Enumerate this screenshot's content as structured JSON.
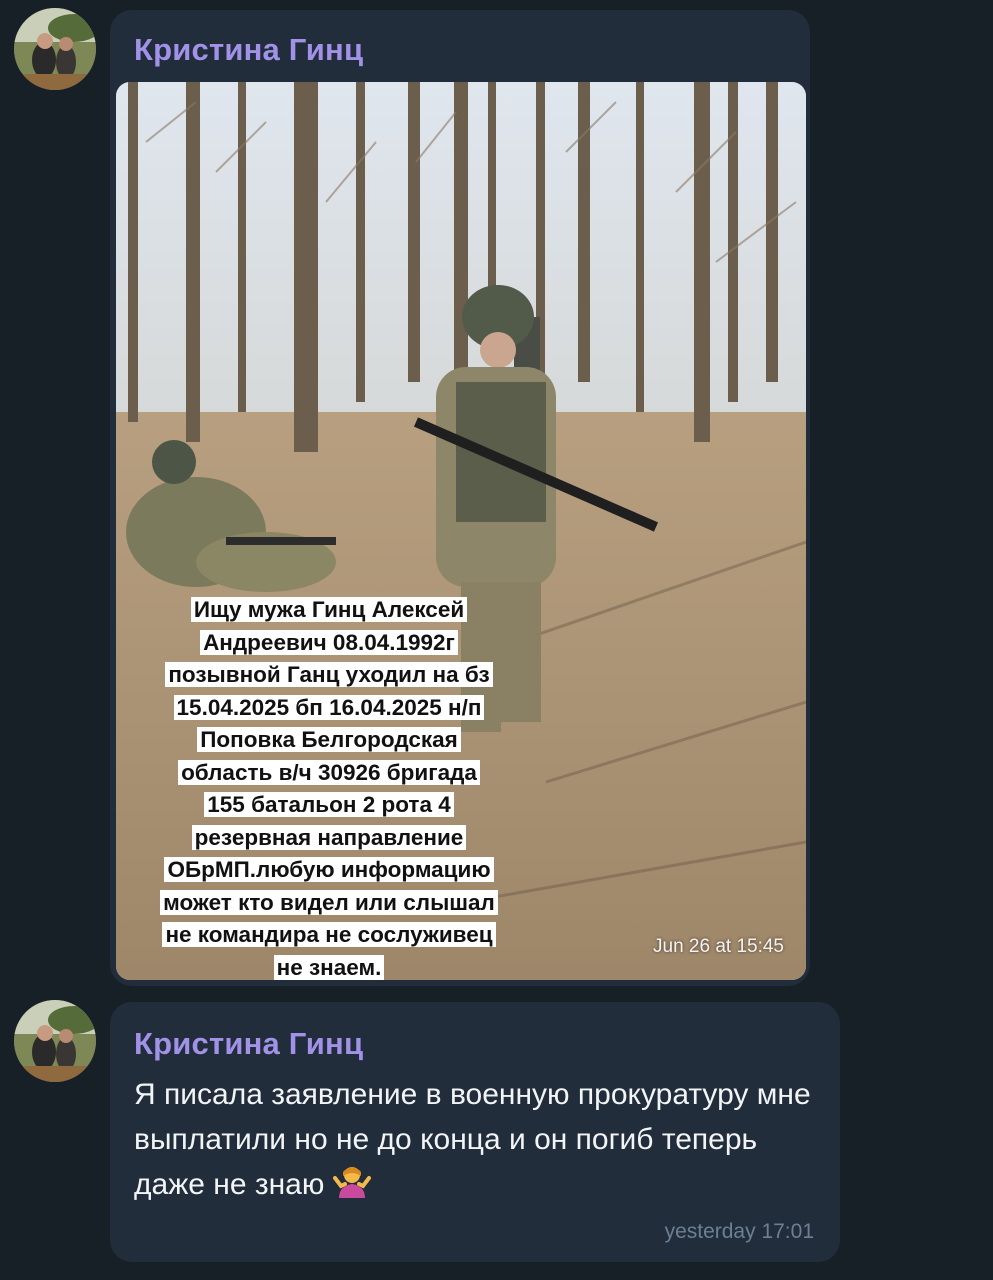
{
  "messages": [
    {
      "sender": "Кристина Гинц",
      "type": "photo",
      "photo_caption_lines": [
        "Ищу мужа Гинц Алексей",
        "Андреевич 08.04.1992г",
        "позывной Ганц уходил на бз",
        "15.04.2025 бп 16.04.2025 н/п",
        "Поповка Белгородская",
        "область в/ч 30926 бригада",
        "155 батальон 2 рота 4",
        "резервная направление",
        "ОБрМП.любую информацию",
        "может кто видел или слышал",
        "не командира не сослуживец",
        "не знаем."
      ],
      "time": "Jun 26 at 15:45",
      "avatar_icon": "profile-photo-avatar"
    },
    {
      "sender": "Кристина Гинц",
      "type": "text",
      "text": "Я писала заявление в военную прокуратуру мне выплатили но не до конца и он погиб теперь даже не знаю",
      "emoji": "person-shrugging-emoji",
      "time": "yesterday 17:01",
      "avatar_icon": "profile-photo-avatar"
    }
  ],
  "colors": {
    "background": "#182027",
    "bubble": "#212d3b",
    "sender_name": "#a192e8",
    "text": "#f2f4f6",
    "timestamp": "#6d7f92"
  }
}
